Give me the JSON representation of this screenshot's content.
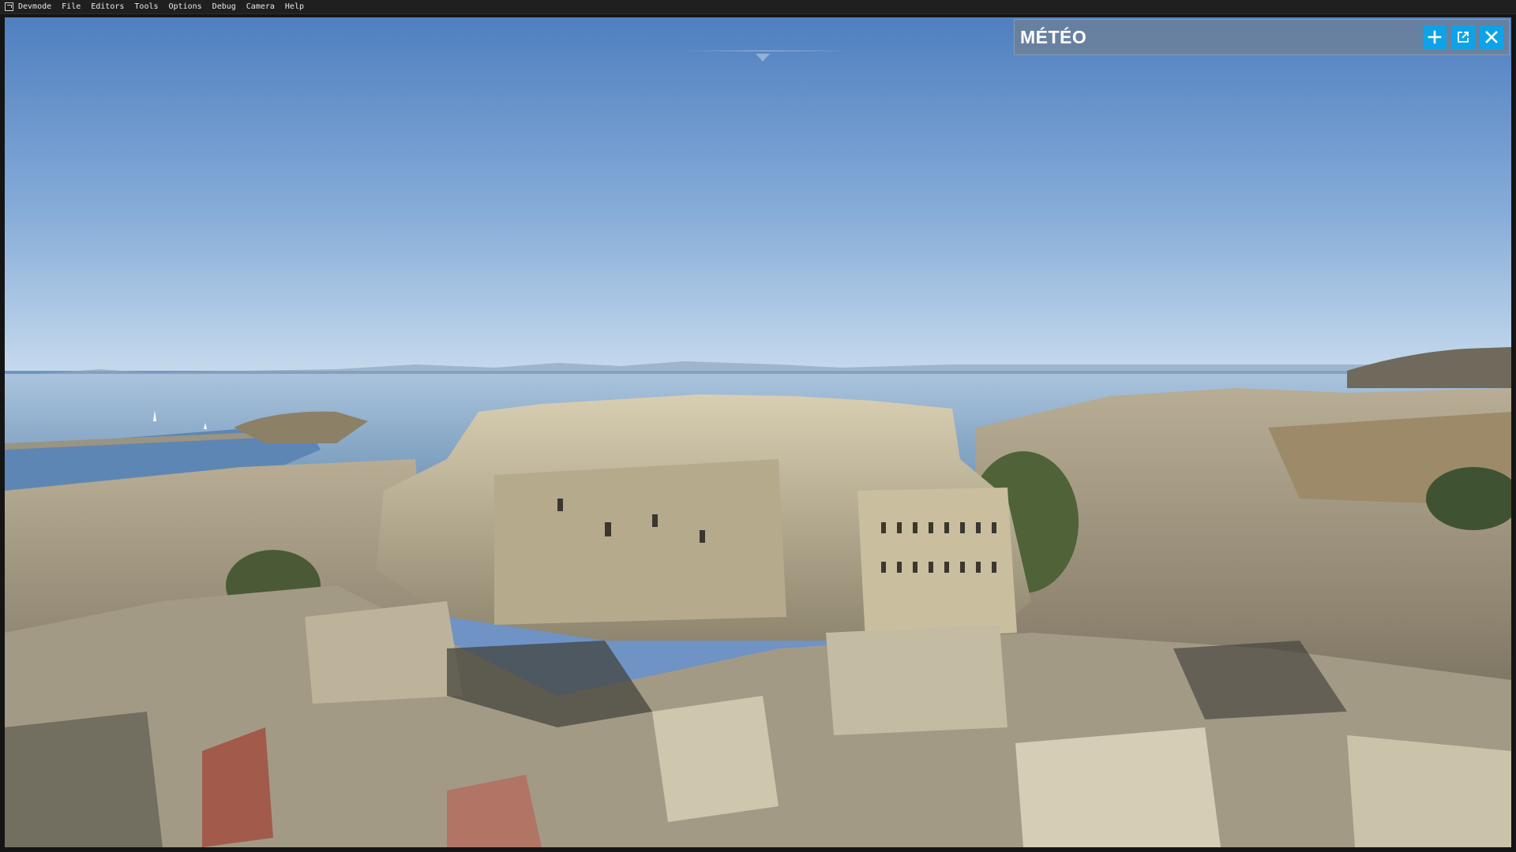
{
  "menubar": {
    "app_icon": "devmode-icon",
    "items": [
      "Devmode",
      "File",
      "Editors",
      "Tools",
      "Options",
      "Debug",
      "Camera",
      "Help"
    ]
  },
  "weather_panel": {
    "title": "MÉTÉO",
    "buttons": [
      {
        "icon": "plus-icon",
        "action": "add"
      },
      {
        "icon": "external-window-icon",
        "action": "undock"
      },
      {
        "icon": "close-icon",
        "action": "close"
      }
    ]
  },
  "colors": {
    "accent": "#0ea2e8",
    "panel_bg": "#6e8096",
    "menubar_bg": "#1f1f1f",
    "sky_top": "#4f7fc0",
    "sky_horizon": "#b9d2ea",
    "sea": "#7fa2c2"
  }
}
